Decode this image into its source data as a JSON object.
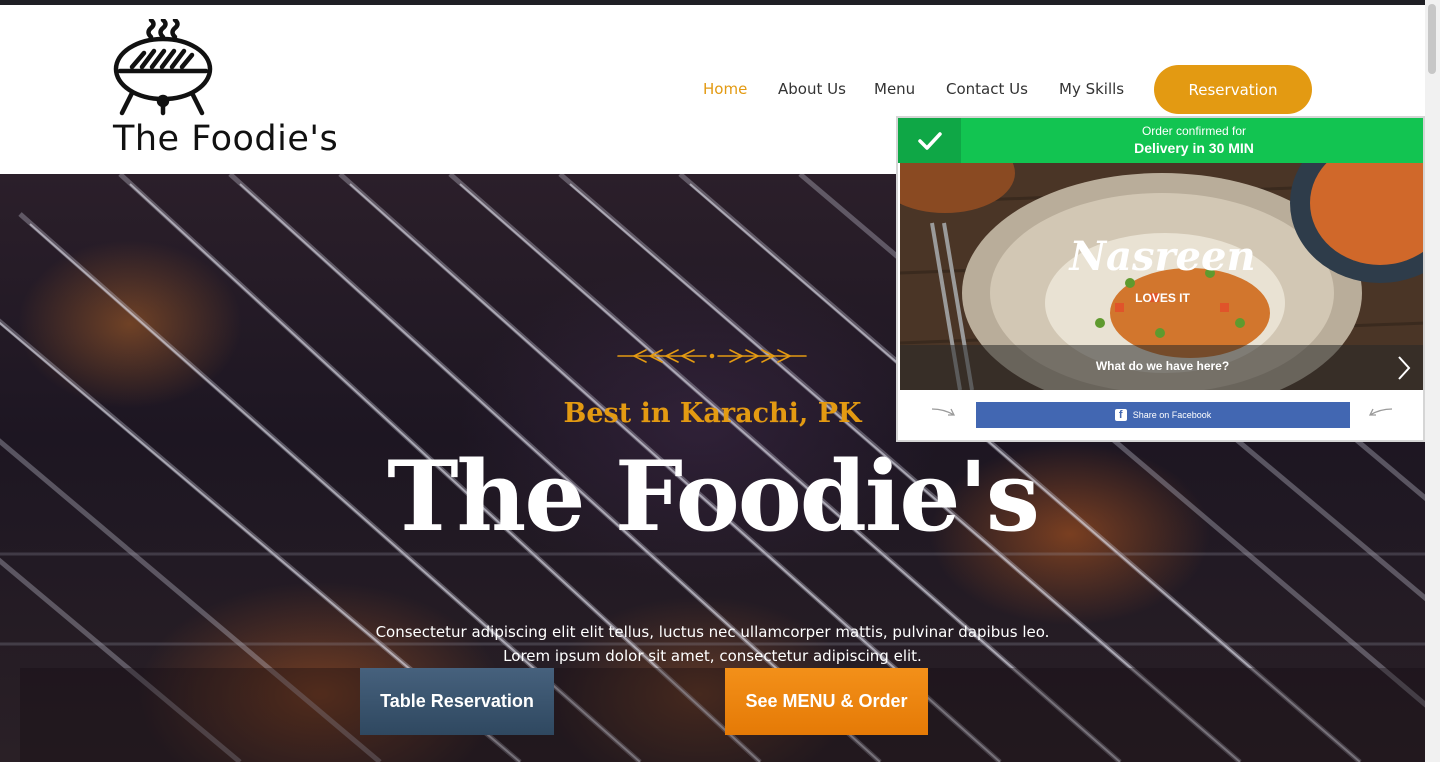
{
  "brand": {
    "name": "The Foodie's"
  },
  "nav": {
    "items": [
      {
        "label": "Home",
        "active": true
      },
      {
        "label": "About Us"
      },
      {
        "label": "Menu"
      },
      {
        "label": "Contact Us"
      },
      {
        "label": "My Skills"
      }
    ],
    "cta_label": "Reservation"
  },
  "hero": {
    "subtitle": "Best in Karachi, PK",
    "title": "The Foodie's",
    "description": "Consectetur adipiscing elit elit tellus, luctus nec ullamcorper mattis, pulvinar dapibus leo. Lorem ipsum dolor sit amet, consectetur adipiscing elit.",
    "buttons": {
      "table": "Table Reservation",
      "menu": "See MENU & Order"
    }
  },
  "popup": {
    "status_line": "Order confirmed for",
    "delivery_line": "Delivery in 30 MIN",
    "customer_name": "Nasreen",
    "loves": "LOVES IT",
    "question": "What do we have here?",
    "share_label": "Share on Facebook"
  },
  "colors": {
    "accent": "#e39a12",
    "popup_green": "#12c451",
    "facebook_blue": "#4267b2",
    "table_button": "#3a536d",
    "menu_button": "#ef8a12"
  }
}
